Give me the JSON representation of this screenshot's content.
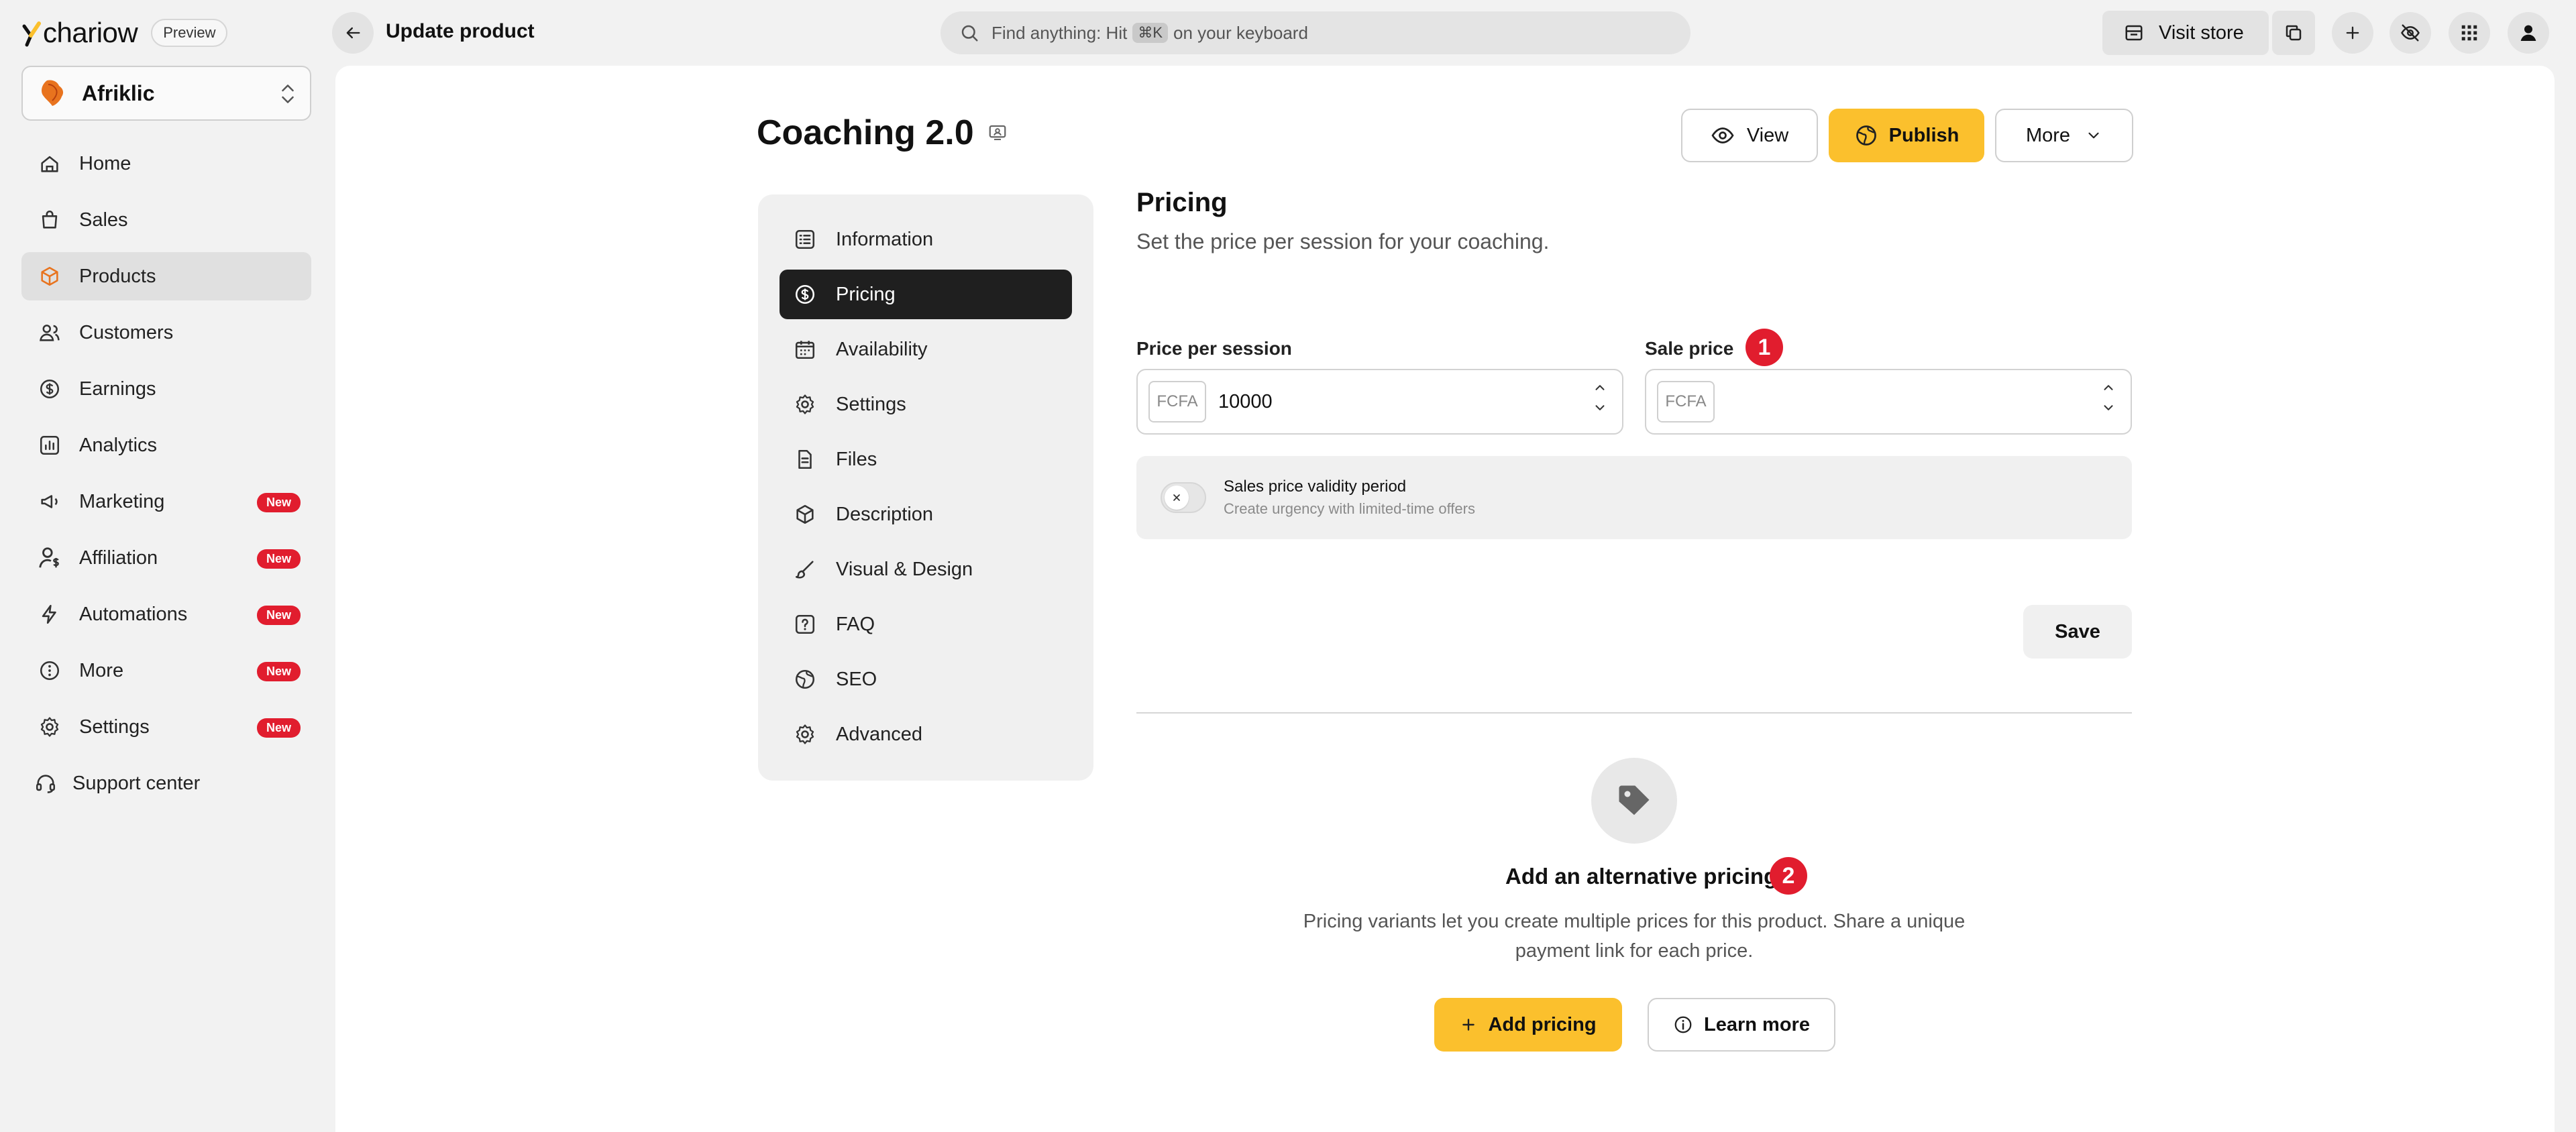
{
  "app": {
    "brand_name": "chariow",
    "preview_badge": "Preview",
    "page_heading": "Update product"
  },
  "search": {
    "text_before": "Find anything: Hit",
    "shortcut": "⌘K",
    "text_after": "on your keyboard"
  },
  "topbar": {
    "visit_store": "Visit store",
    "icons": [
      "store-icon",
      "copy-icon",
      "plus-icon",
      "eye-off-icon",
      "apps-grid-icon",
      "user-avatar-icon"
    ]
  },
  "store": {
    "name": "Afriklic",
    "logo_text": "AfriClic"
  },
  "sidebar": {
    "items": [
      {
        "label": "Home",
        "icon": "home-icon",
        "active": false,
        "badge": ""
      },
      {
        "label": "Sales",
        "icon": "shopping-bag-icon",
        "active": false,
        "badge": ""
      },
      {
        "label": "Products",
        "icon": "box-icon",
        "active": true,
        "badge": ""
      },
      {
        "label": "Customers",
        "icon": "users-icon",
        "active": false,
        "badge": ""
      },
      {
        "label": "Earnings",
        "icon": "dollar-circle-icon",
        "active": false,
        "badge": ""
      },
      {
        "label": "Analytics",
        "icon": "chart-icon",
        "active": false,
        "badge": ""
      },
      {
        "label": "Marketing",
        "icon": "megaphone-icon",
        "active": false,
        "badge": "New"
      },
      {
        "label": "Affiliation",
        "icon": "user-dollar-icon",
        "active": false,
        "badge": "New"
      },
      {
        "label": "Automations",
        "icon": "bolt-icon",
        "active": false,
        "badge": "New"
      },
      {
        "label": "More",
        "icon": "more-icon",
        "active": false,
        "badge": "New"
      },
      {
        "label": "Settings",
        "icon": "gear-icon",
        "active": false,
        "badge": "New"
      }
    ],
    "support": "Support center"
  },
  "product": {
    "title": "Coaching 2.0",
    "actions": {
      "view": "View",
      "publish": "Publish",
      "more": "More"
    }
  },
  "subnav": {
    "items": [
      {
        "label": "Information",
        "icon": "list-icon",
        "active": false
      },
      {
        "label": "Pricing",
        "icon": "dollar-circle-icon",
        "active": true
      },
      {
        "label": "Availability",
        "icon": "calendar-icon",
        "active": false
      },
      {
        "label": "Settings",
        "icon": "gear-icon",
        "active": false
      },
      {
        "label": "Files",
        "icon": "file-icon",
        "active": false
      },
      {
        "label": "Description",
        "icon": "box-icon",
        "active": false
      },
      {
        "label": "Visual & Design",
        "icon": "brush-icon",
        "active": false
      },
      {
        "label": "FAQ",
        "icon": "question-icon",
        "active": false
      },
      {
        "label": "SEO",
        "icon": "globe-icon",
        "active": false
      },
      {
        "label": "Advanced",
        "icon": "gear-icon",
        "active": false
      }
    ]
  },
  "pricing": {
    "title": "Pricing",
    "description": "Set the price per session for your coaching.",
    "price_label": "Price per session",
    "price_currency": "FCFA",
    "price_value": "10000",
    "sale_label": "Sale price",
    "sale_currency": "FCFA",
    "sale_value": "",
    "validity_title": "Sales price validity period",
    "validity_subtitle": "Create urgency with limited-time offers",
    "validity_enabled": false,
    "save": "Save"
  },
  "annotations": {
    "one": "1",
    "two": "2"
  },
  "alternative": {
    "title": "Add an alternative pricing",
    "description": "Pricing variants let you create multiple prices for this product. Share a unique payment link for each price.",
    "add_button": "Add pricing",
    "learn_button": "Learn more"
  },
  "colors": {
    "accent_yellow": "#fbc02d",
    "badge_red": "#e11d2e",
    "active_dark": "#1f1f1f",
    "sidebar_active": "#e0e0e0"
  }
}
